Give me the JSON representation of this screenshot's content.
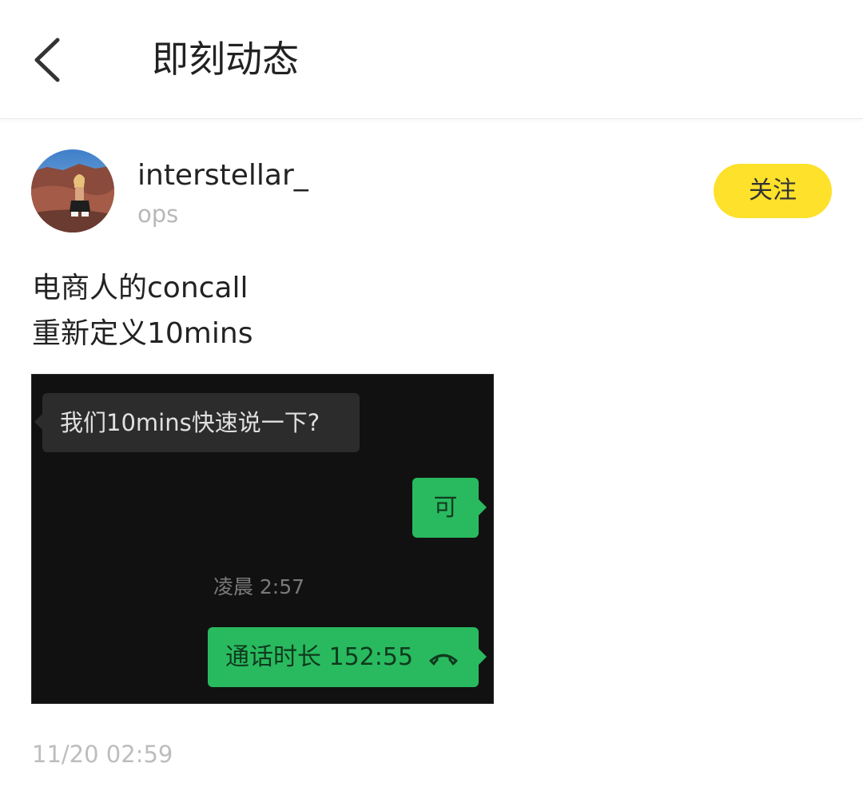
{
  "header": {
    "back_icon": "chevron-left-icon",
    "title": "即刻动态"
  },
  "post": {
    "author": {
      "username": "interstellar_",
      "subtitle": "ops"
    },
    "follow_label": "关注",
    "text_lines": [
      "电商人的concall",
      "重新定义10mins"
    ],
    "image": {
      "incoming_message": "我们10mins快速说一下?",
      "outgoing_reply": "可",
      "time_divider": "凌晨 2:57",
      "call_bubble": "通话时长 152:55",
      "call_icon": "phone-hangup-icon"
    },
    "timestamp": "11/20 02:59"
  },
  "colors": {
    "follow_button": "#fde12a",
    "chat_bg": "#111111",
    "bubble_green": "#29ba5f",
    "bubble_dark": "#2c2c2c"
  }
}
